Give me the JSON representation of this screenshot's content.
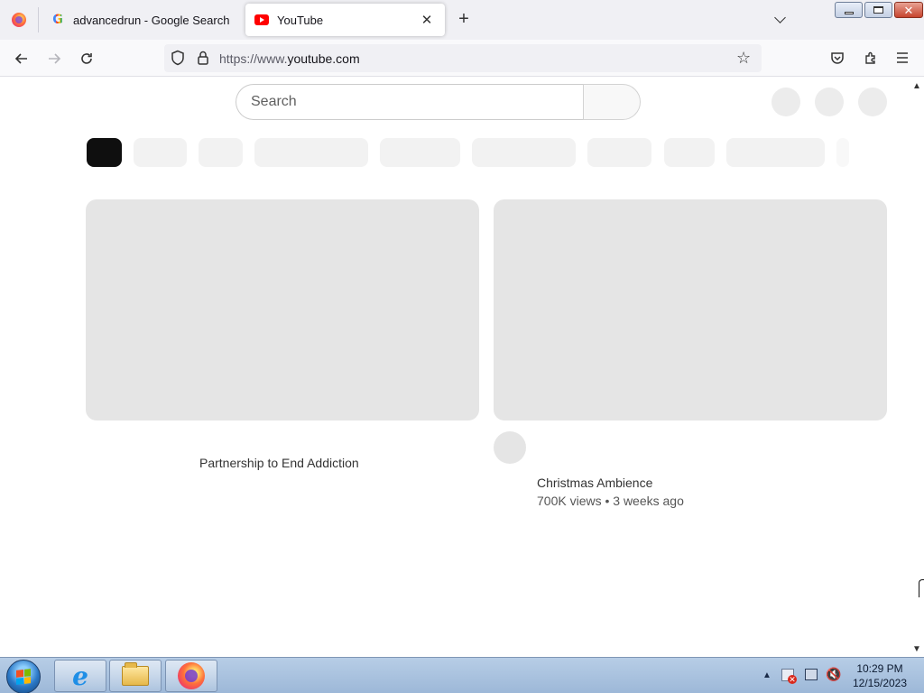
{
  "browser": {
    "tabs": [
      {
        "title": "advancedrun - Google Search",
        "favicon": "google-g-icon",
        "active": false
      },
      {
        "title": "YouTube",
        "favicon": "youtube-icon",
        "active": true
      }
    ],
    "new_tab_label": "+",
    "url_prefix": "https://www.",
    "url_domain": "youtube.com"
  },
  "youtube": {
    "search_placeholder": "Search",
    "videos": [
      {
        "title": "Partnership to End Addiction",
        "meta": ""
      },
      {
        "title": "Christmas Ambience",
        "meta": "700K views • 3 weeks ago"
      }
    ]
  },
  "taskbar": {
    "pinned": [
      "internet-explorer-icon",
      "file-explorer-icon",
      "firefox-icon"
    ],
    "clock_time": "10:29 PM",
    "clock_date": "12/15/2023"
  },
  "colors": {
    "active_chip": "#0f0f0f",
    "skeleton": "#e5e5e5",
    "youtube_red": "#ff0000"
  }
}
